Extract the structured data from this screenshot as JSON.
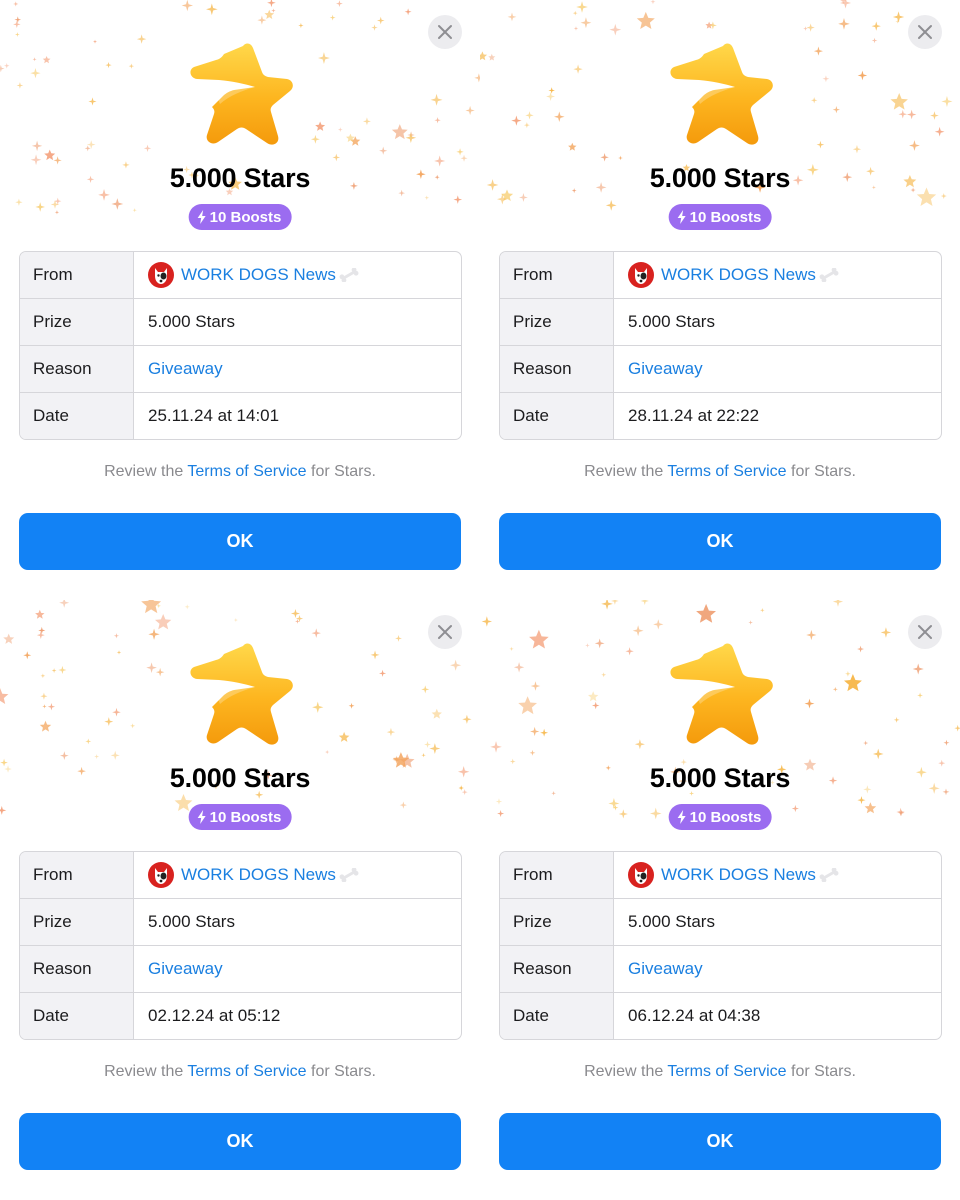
{
  "common": {
    "title": "5.000 Stars",
    "boosts": "10 Boosts",
    "labels": {
      "from": "From",
      "prize": "Prize",
      "reason": "Reason",
      "date": "Date"
    },
    "from_name": "WORK DOGS News",
    "prize_value": "5.000 Stars",
    "reason_value": "Giveaway",
    "terms_prefix": "Review the ",
    "terms_link": "Terms of Service",
    "terms_suffix": " for Stars.",
    "ok_label": "OK"
  },
  "panels": [
    {
      "date": "25.11.24 at 14:01"
    },
    {
      "date": "28.11.24 at 22:22"
    },
    {
      "date": "02.12.24 at 05:12"
    },
    {
      "date": "06.12.24 at 04:38"
    }
  ],
  "colors": {
    "accent_blue": "#1282f5",
    "link_blue": "#1a7fe0",
    "boost_purple": "#9b6cf0",
    "star_gold": "#fbb51f",
    "avatar_red": "#d8221f"
  },
  "icons": [
    "close-icon",
    "bolt-icon",
    "star-icon",
    "dog-avatar",
    "bone-icon",
    "sparkle-icon"
  ]
}
